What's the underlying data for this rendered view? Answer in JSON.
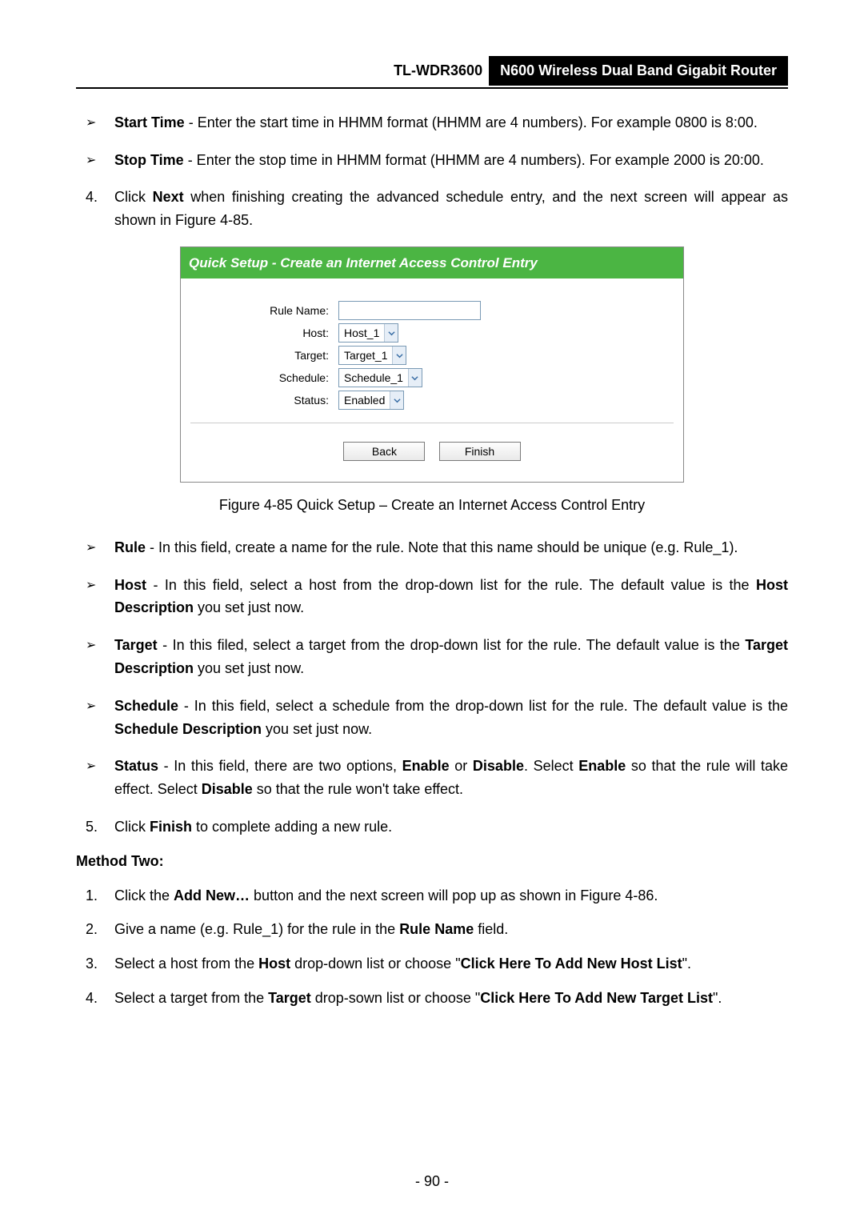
{
  "header": {
    "model": "TL-WDR3600",
    "title": "N600 Wireless Dual Band Gigabit Router"
  },
  "time_items": {
    "start": {
      "label": "Start Time",
      "text": " - Enter the start time in HHMM format (HHMM are 4 numbers). For example 0800 is 8:00."
    },
    "stop": {
      "label": "Stop Time",
      "text": " - Enter the stop time in HHMM format (HHMM are 4 numbers). For example 2000 is 20:00."
    }
  },
  "step4": {
    "num": "4.",
    "pre": "Click ",
    "next": "Next",
    "post": " when finishing creating the advanced schedule entry, and the next screen will appear as shown in Figure 4-85."
  },
  "panel": {
    "title": "Quick Setup - Create an Internet Access Control Entry",
    "rule_name_label": "Rule Name:",
    "host_label": "Host:",
    "target_label": "Target:",
    "schedule_label": "Schedule:",
    "status_label": "Status:",
    "host_value": "Host_1",
    "target_value": "Target_1",
    "schedule_value": "Schedule_1",
    "status_value": "Enabled",
    "back": "Back",
    "finish": "Finish"
  },
  "fig_caption": "Figure 4-85 Quick Setup – Create an Internet Access Control Entry",
  "desc": {
    "rule": {
      "label": "Rule",
      "text": " - In this field, create a name for the rule. Note that this name should be unique (e.g. Rule_1)."
    },
    "host": {
      "label": "Host",
      "text_pre": " - In this field, select a host from the drop-down list for the rule. The default value is the ",
      "bold": "Host Description",
      "text_post": " you set just now."
    },
    "target": {
      "label": "Target",
      "text_pre": " - In this filed, select a target from the drop-down list for the rule. The default value is the ",
      "bold": "Target Description",
      "text_post": " you set just now."
    },
    "schedule": {
      "label": "Schedule",
      "text_pre": " - In this field, select a schedule from the drop-down list for the rule. The default value is the ",
      "bold": "Schedule Description",
      "text_post": " you set just now."
    },
    "status": {
      "label": "Status",
      "p1": " - In this field, there are two options, ",
      "b1": "Enable",
      "p2": " or ",
      "b2": "Disable",
      "p3": ". Select ",
      "b3": "Enable",
      "p4": " so that the rule will take effect. Select ",
      "b4": "Disable",
      "p5": " so that the rule won't take effect."
    }
  },
  "step5": {
    "num": "5.",
    "pre": "Click ",
    "b": "Finish",
    "post": " to complete adding a new rule."
  },
  "method_two": "Method Two:",
  "m2": {
    "i1": {
      "num": "1.",
      "pre": "Click the ",
      "b": "Add New…",
      "post": " button and the next screen will pop up as shown in Figure 4-86."
    },
    "i2": {
      "num": "2.",
      "pre": "Give a name (e.g. Rule_1) for the rule in the ",
      "b": "Rule Name",
      "post": " field."
    },
    "i3": {
      "num": "3.",
      "pre": "Select a host from the ",
      "b1": "Host",
      "mid": " drop-down list or choose \"",
      "b2": "Click Here To Add New Host List",
      "post": "\"."
    },
    "i4": {
      "num": "4.",
      "pre": "Select a target from the ",
      "b1": "Target",
      "mid": " drop-sown list or choose \"",
      "b2": "Click Here To Add New Target List",
      "post": "\"."
    }
  },
  "page_number": "- 90 -"
}
